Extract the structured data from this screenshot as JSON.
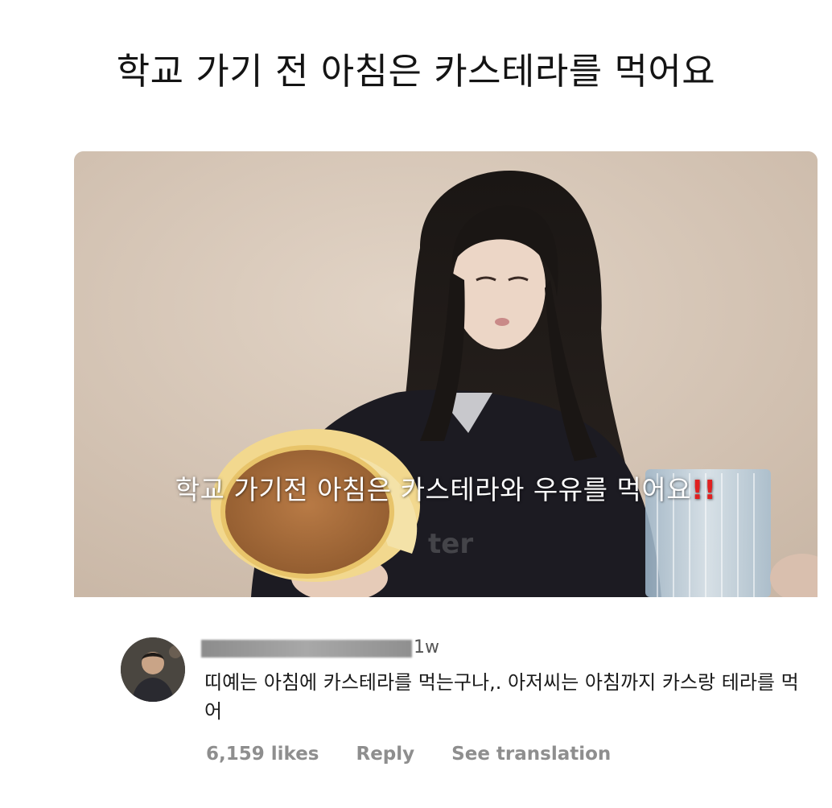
{
  "headline": "학교 가기 전 아침은 카스테라를 먹어요",
  "video": {
    "subtitle_text": "학교 가기전 아침은 카스테라와 우유를 먹어요",
    "subtitle_emphasis": "!!",
    "watermark": "ter"
  },
  "comment": {
    "time": "1w",
    "text": "띠예는 아침에 카스테라를 먹는구나,. 아저씨는 아침까지 카스랑 테라를 먹어",
    "likes": "6,159 likes",
    "reply_label": "Reply",
    "translate_label": "See translation"
  },
  "colors": {
    "accent_red": "#e02020",
    "meta_gray": "#8e8e8e"
  }
}
